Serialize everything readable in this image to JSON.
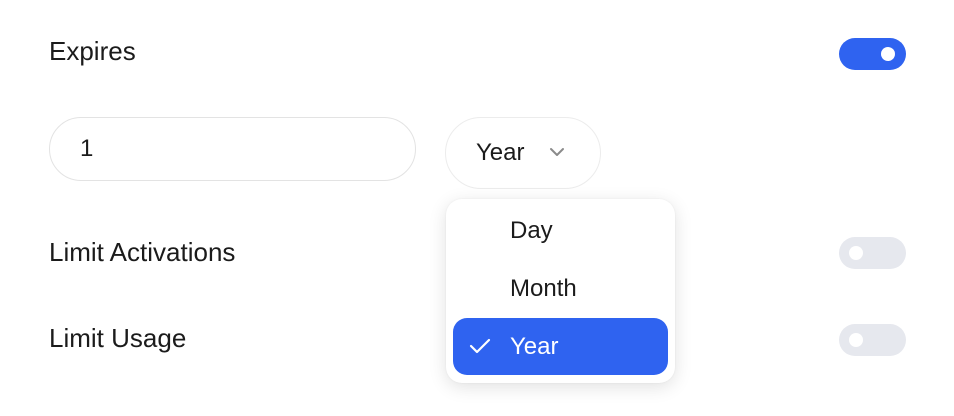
{
  "expires": {
    "label": "Expires",
    "enabled": true,
    "duration_value": "1",
    "unit_selected": "Year",
    "unit_options": [
      "Day",
      "Month",
      "Year"
    ]
  },
  "limit_activations": {
    "label": "Limit Activations",
    "enabled": false
  },
  "limit_usage": {
    "label": "Limit Usage",
    "enabled": false
  },
  "colors": {
    "accent": "#2f63f0",
    "toggle_off": "#e6e8ee"
  },
  "icons": {
    "select_chevron": "chevron-down-icon",
    "selected_check": "check-icon"
  }
}
